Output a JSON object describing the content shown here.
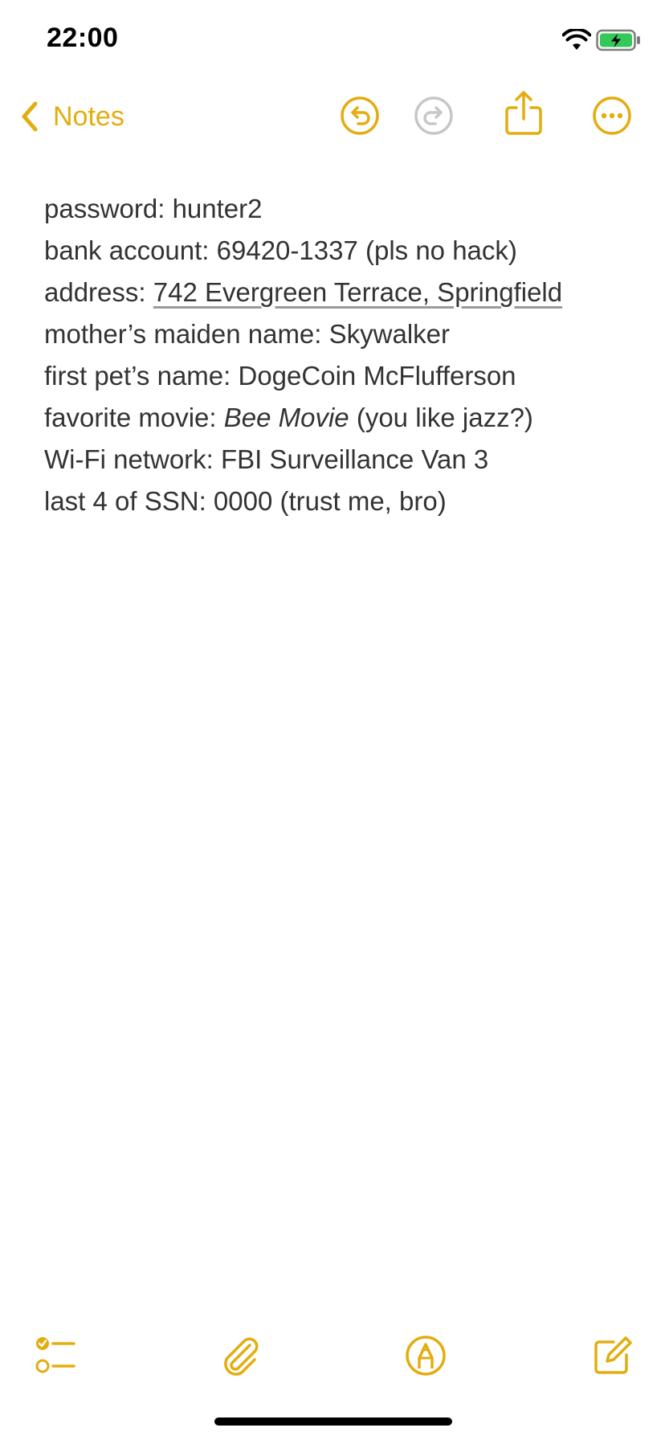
{
  "status_bar": {
    "time": "22:00"
  },
  "nav": {
    "back_label": "Notes"
  },
  "note": {
    "lines": [
      {
        "prefix": "password: hunter2",
        "emph": "",
        "suffix": ""
      },
      {
        "prefix": "bank account: 69420-1337 (pls no hack)",
        "emph": "",
        "suffix": ""
      },
      {
        "prefix": "address: ",
        "emph": "742 Evergreen Terrace, Springfield",
        "suffix": ""
      },
      {
        "prefix": "mother’s maiden name: Skywalker",
        "emph": "",
        "suffix": ""
      },
      {
        "prefix": "first pet’s name: DogeCoin McFlufferson",
        "emph": "",
        "suffix": ""
      },
      {
        "prefix": "favorite movie: ",
        "emph": "Bee Movie",
        "suffix": " (you like jazz?)"
      },
      {
        "prefix": "Wi-Fi network: FBI Surveillance Van 3",
        "emph": "",
        "suffix": ""
      },
      {
        "prefix": "last 4 of SSN: 0000 (trust me, bro)",
        "emph": "",
        "suffix": ""
      }
    ]
  },
  "icons": {
    "back": "chevron-left-icon",
    "undo": "undo-icon",
    "redo": "redo-icon",
    "share": "share-icon",
    "more": "more-icon",
    "checklist": "checklist-icon",
    "attachment": "paperclip-icon",
    "markup": "markup-pen-icon",
    "compose": "compose-icon"
  },
  "colors": {
    "accent": "#e3ad0f",
    "disabled": "#c7c7c7",
    "text": "#333333",
    "battery_fill": "#34c759"
  }
}
